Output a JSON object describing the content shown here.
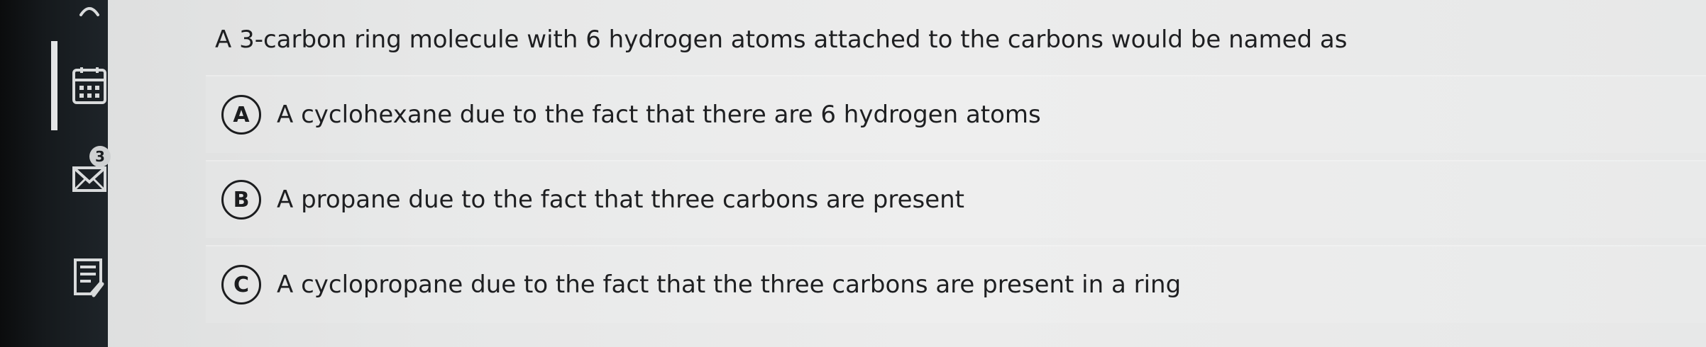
{
  "sidebar": {
    "items": [
      {
        "icon": "close-icon"
      },
      {
        "icon": "calendar-icon"
      },
      {
        "icon": "mail-icon",
        "badge": "3"
      },
      {
        "icon": "notes-icon"
      }
    ]
  },
  "question": {
    "text": "A 3-carbon ring molecule with 6 hydrogen atoms attached to the carbons would be named as",
    "options": [
      {
        "letter": "A",
        "text": "A cyclohexane due to the fact that there are 6 hydrogen atoms"
      },
      {
        "letter": "B",
        "text": "A propane due to the fact that three carbons are present"
      },
      {
        "letter": "C",
        "text": "A cyclopropane due to the fact that the three carbons are present in a ring"
      }
    ]
  },
  "colors": {
    "sidebar_bg": "#15191c",
    "text": "#1e1f21",
    "page_bg": "#e9eaea"
  }
}
